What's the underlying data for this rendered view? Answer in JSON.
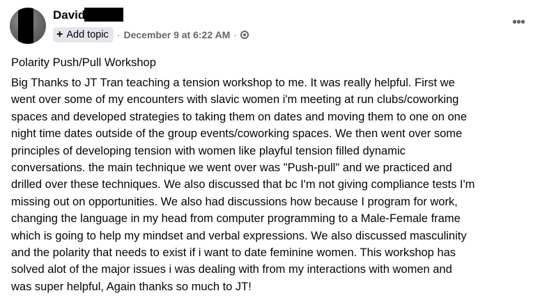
{
  "post": {
    "author": "David",
    "add_topic_label": "Add topic",
    "separator": "·",
    "date": "December 9 at 6:22 AM",
    "privacy_icon": "globe-icon",
    "more_icon": "more-options-icon",
    "title": "Polarity Push/Pull Workshop",
    "body_lines": [
      "Big Thanks to JT Tran teaching a tension workshop to me. It was really helpful. First we",
      "went over some of my encounters with slavic women i'm meeting at run clubs/coworking",
      "spaces and developed strategies to taking them on dates and moving them to one on one",
      "night time dates outside of the group events/coworking spaces. We then went over some",
      "principles of developing tension with women like playful tension filled dynamic",
      "conversations. the main technique we went over was \"Push-pull\" and we practiced and",
      "drilled over these techniques. We also discussed that bc I'm not giving compliance tests I'm",
      "missing out on opportunities. We also had discussions how because I program for work,",
      "changing the language in my head from computer programming to a Male-Female frame",
      "which is going to help my mindset and verbal expressions. We also discussed masculinity",
      "and the polarity that needs to exist if i want to date feminine women. This workshop has",
      "solved alot of the major issues i was dealing with from my interactions with women and",
      "was super helpful, Again thanks so much to JT!"
    ]
  }
}
